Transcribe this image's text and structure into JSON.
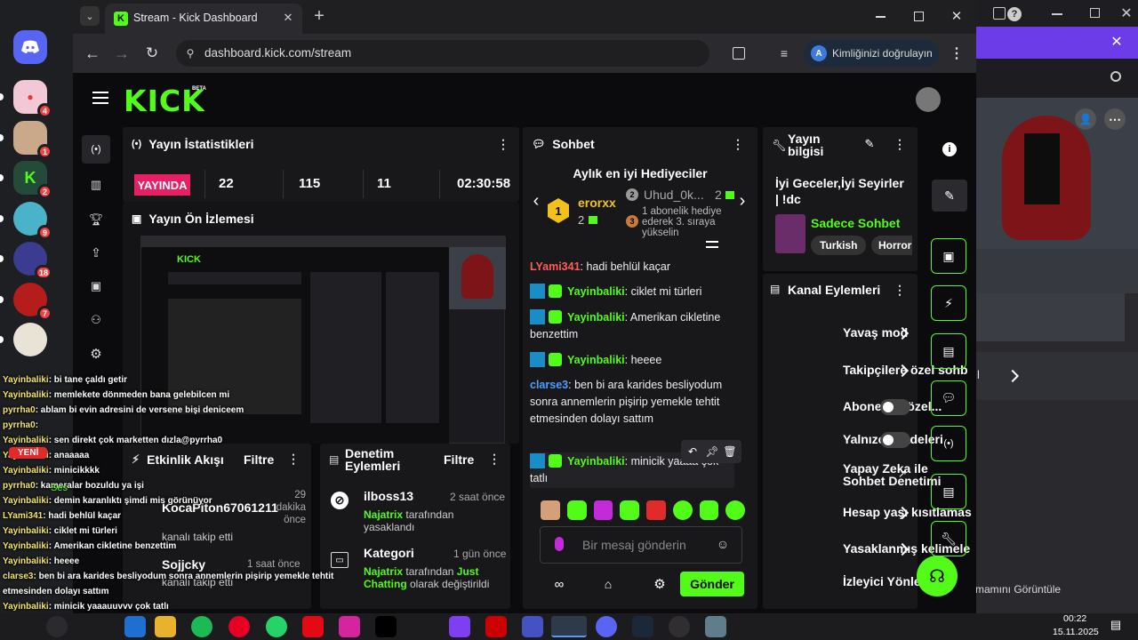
{
  "colors": {
    "accent": "#53fc18",
    "live": "#e91e63",
    "link": "#4f9dff"
  },
  "discord": {
    "badges": [
      "4",
      "1",
      "2",
      "9",
      "18",
      "7"
    ],
    "sesli_label": "Ses"
  },
  "browser": {
    "tab_title": "Stream - Kick Dashboard",
    "url": "dashboard.kick.com/stream",
    "profile_label": "Kimliğinizi doğrulayın",
    "profile_initial": "A"
  },
  "kick": {
    "logo": "KICK",
    "logo_beta": "BETA"
  },
  "stats": {
    "title": "Yayın İstatistikleri",
    "live": "YAYINDA",
    "values": [
      "22",
      "115",
      "11",
      "02:30:58"
    ]
  },
  "preview": {
    "title": "Yayın Ön İzlemesi"
  },
  "activity": {
    "title": "Etkinlik Akışı",
    "filter": "Filtre",
    "items": [
      {
        "user": "KocaPiton67061211",
        "action": "kanalı takip etti",
        "time": "29 dakika önce"
      },
      {
        "user": "Sojjcky",
        "action": "kanalı takip etti",
        "time": "1 saat önce"
      }
    ]
  },
  "moderation": {
    "title": "Denetim Eylemleri",
    "filter": "Filtre",
    "items": [
      {
        "target": "ilboss13",
        "time": "2 saat önce",
        "by": "Najatrix",
        "text": "tarafından yasaklandı"
      },
      {
        "target": "Kategori",
        "time": "1 gün önce",
        "by": "Najatrix",
        "text1": "tarafından",
        "cat": "Just Chatting",
        "text2": "olarak değiştirildi"
      }
    ]
  },
  "chat": {
    "title": "Sohbet",
    "gifters_title": "Aylık en iyi Hediyeciler",
    "top_gifter": {
      "rank": "1",
      "name": "erorxx",
      "count": "2"
    },
    "second": {
      "rank": "2",
      "name": "Uhud_0k...",
      "count": "2"
    },
    "third": {
      "rank": "3",
      "text": "1 abonelik hediye ederek 3. sıraya yükselin"
    },
    "messages": [
      {
        "user": "LYami341",
        "text": "hadi behlül kaçar",
        "color": "#ff5c5c",
        "badges": false
      },
      {
        "user": "Yayinbaliki",
        "text": "ciklet mi türleri",
        "color": "#53fc18",
        "badges": true
      },
      {
        "user": "Yayinbaliki",
        "text": "Amerikan cikletine benzettim",
        "color": "#53fc18",
        "badges": true
      },
      {
        "user": "Yayinbaliki",
        "text": "heeee",
        "color": "#53fc18",
        "badges": true
      },
      {
        "user": "clarse3",
        "text": "ben bi ara karides besliyodum sonra annemlerin pişirip yemekle tehtit etmesinden dolayı sattım",
        "color": "#4f9dff",
        "badges": false
      },
      {
        "user": "Yayinbaliki",
        "text": "minicik yaaaa çok tatlı",
        "color": "#53fc18",
        "badges": true
      }
    ],
    "placeholder": "Bir mesaj gönderin",
    "send": "Gönder"
  },
  "info": {
    "title": "Yayın bilgisi",
    "stream_title": "İyi Geceler,İyi Seyirler | !dc",
    "category": "Sadece Sohbet",
    "tags": [
      "Turkish",
      "Horror"
    ]
  },
  "channel": {
    "title": "Kanal Eylemleri",
    "items": [
      {
        "label": "Yavaş mod",
        "kind": "chevron"
      },
      {
        "label": "Takipçilere özel sohb",
        "kind": "chevron"
      },
      {
        "label": "Abonelere özel...",
        "kind": "toggle"
      },
      {
        "label": "Yalnızca ifadeleri...",
        "kind": "toggle"
      },
      {
        "label": "Yapay Zeka ile Sohbet Denetimi",
        "kind": "external"
      },
      {
        "label": "Hesap yaşı kısıtlamas",
        "kind": "chevron"
      },
      {
        "label": "Yasaklanmış kelimele",
        "kind": "chevron"
      },
      {
        "label": "İzleyici Yönlendir",
        "kind": "none"
      }
    ]
  },
  "overlay": [
    {
      "user": "Yayinbaliki",
      "text": ": bi tane çaldı getir"
    },
    {
      "user": "Yayinbaliki",
      "text": ": memlekete dönmeden bana gelebilcen mi"
    },
    {
      "user": "pyrrha0",
      "text": ": ablam bi evin adresini de versene bişi deniceem"
    },
    {
      "user": "pyrrha0",
      "text": ":"
    },
    {
      "user": "Yayinbaliki",
      "text": ": sen direkt çok marketten dızla@pyrrha0"
    },
    {
      "user": "Yayinbaliki",
      "text": ": anaaaaa"
    },
    {
      "user": "Yayinbaliki",
      "text": ": minicikkkk"
    },
    {
      "user": "pyrrha0",
      "text": ": kameralar bozuldu ya işi"
    },
    {
      "user": "Yayinbaliki",
      "text": ": demin karanlıktı şimdi mis görünüyor"
    },
    {
      "user": "LYami341",
      "text": ": hadi behlül kaçar"
    },
    {
      "user": "Yayinbaliki",
      "text": ": ciklet mi türleri"
    },
    {
      "user": "Yayinbaliki",
      "text": ": Amerikan cikletine benzettim"
    },
    {
      "user": "Yayinbaliki",
      "text": ": heeee"
    },
    {
      "user": "clarse3",
      "text": ": ben bi ara karides besliyodum sonra annemlerin pişirip yemekle tehtit"
    },
    {
      "user": "",
      "text": "etmesinden dolayı sattım"
    },
    {
      "user": "Yayinbaliki",
      "text": ": minicik yaaauuvvv çok tatlı"
    }
  ],
  "overlay_yeni": "YENİ",
  "right_window": {
    "text_bottom": "mamını Görüntüle",
    "text_mid": "l"
  },
  "taskbar": {
    "time": "00:22",
    "date": "15.11.2025"
  }
}
